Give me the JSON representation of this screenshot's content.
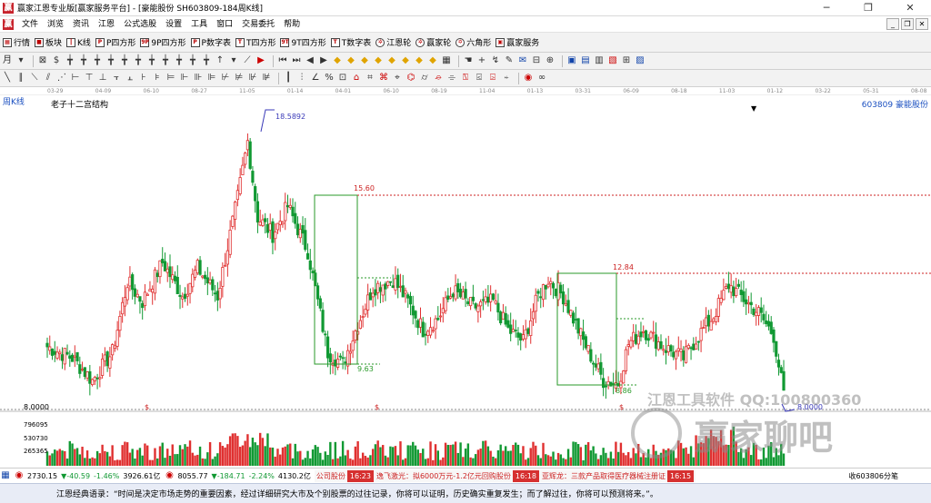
{
  "window": {
    "title": "赢家江恩专业版[赢家服务平台] - [豪能股份  SH603809-184周K线]",
    "minimize": "─",
    "restore": "❐",
    "close": "✕"
  },
  "menubar": {
    "items": [
      "文件",
      "浏览",
      "资讯",
      "江恩",
      "公式选股",
      "设置",
      "工具",
      "窗口",
      "交易委托",
      "帮助"
    ],
    "mdi_min": "_",
    "mdi_restore": "❐",
    "mdi_close": "✕"
  },
  "funcbar": {
    "items": [
      {
        "icon": "grid",
        "label": "行情"
      },
      {
        "icon": "blocks",
        "label": "板块"
      },
      {
        "icon": "kline",
        "label": "K线"
      },
      {
        "icon": "P",
        "label": "P四方形"
      },
      {
        "icon": "9P",
        "label": "9P四方形"
      },
      {
        "icon": "P",
        "label": "P数字表"
      },
      {
        "icon": "T",
        "label": "T四方形"
      },
      {
        "icon": "9T",
        "label": "9T四方形"
      },
      {
        "icon": "T",
        "label": "T数字表"
      },
      {
        "icon": "wheel",
        "label": "江恩轮"
      },
      {
        "icon": "wheel",
        "label": "赢家轮"
      },
      {
        "icon": "hex",
        "label": "六角形"
      },
      {
        "icon": "service",
        "label": "赢家服务"
      }
    ]
  },
  "chart_header": {
    "period": "周K线",
    "indicator": "老子十二宫结构",
    "stock_code": "603809",
    "stock_name": "豪能股份",
    "dropdown": "▼"
  },
  "date_axis": [
    "03-29",
    "04-09",
    "06-10",
    "08-27",
    "11-05",
    "01-14",
    "04-01",
    "06-10",
    "08-19",
    "11-04",
    "01-13",
    "03-31",
    "06-09",
    "08-18",
    "11-03",
    "01-12",
    "03-22",
    "05-31",
    "08-08"
  ],
  "annotations": {
    "high": "18.5892",
    "box1_top": "15.60",
    "box1_bottom": "9.63",
    "box2_top": "12.84",
    "box2_bottom": "8.86",
    "current": "8.0000",
    "level_left": "8.0000",
    "dollar": "$"
  },
  "volume_axis": [
    "796095",
    "530730",
    "265365"
  ],
  "watermark": {
    "line1": "江恩工具软件  QQ:100800360",
    "line2": "赢家聊吧"
  },
  "statusbar": {
    "sh_index": "2730.15",
    "sh_change": "▼-40.59",
    "sh_pct": "-1.46%",
    "sh_amount": "3926.61亿",
    "sz_index": "8055.77",
    "sz_change": "▼-184.71",
    "sz_pct": "-2.24%",
    "sz_amount": "4130.2亿",
    "news1_tail": "公司股份",
    "news2_time": "16:23",
    "news2_text": "逸飞激光：拟6000万元-1.2亿元回购股份",
    "news3_time": "16:18",
    "news3_text": "亚辉龙：三款产品取得医疗器械注册证",
    "news4_time": "16:15",
    "right": "收603806分笔"
  },
  "quote": {
    "text": "江恩经典语录：“时间是决定市场走势的重要因素，经过详细研究大市及个别股票的过往记录，你将可以证明，历史确实重复发生；而了解过往，你将可以预测将来。”。"
  },
  "chart_data": {
    "type": "candlestick",
    "symbol": "603809",
    "name": "豪能股份",
    "period": "weekly",
    "y_range": [
      8.0,
      18.5892
    ],
    "high": 18.5892,
    "levels": [
      15.6,
      9.63,
      12.84,
      8.86,
      8.0
    ],
    "colors": {
      "up": "#e03030",
      "down": "#119933",
      "box": "#2a9a2a",
      "level": "#cc2222",
      "annotation": "#3a3ab8"
    }
  }
}
